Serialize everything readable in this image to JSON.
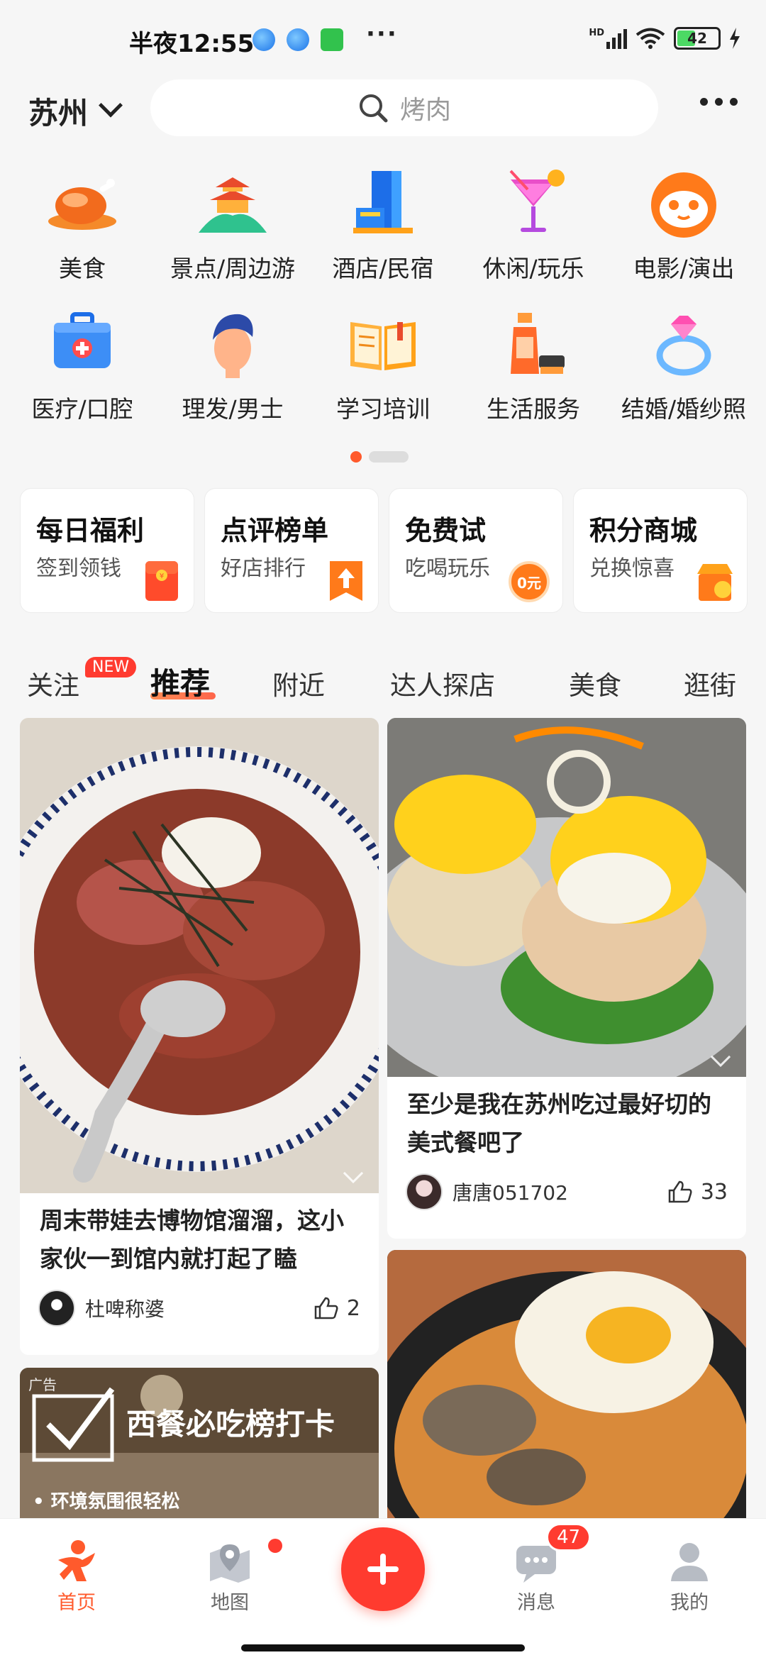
{
  "status_bar": {
    "time": "半夜12:55",
    "battery": "42",
    "network": "HD"
  },
  "header": {
    "city": "苏州",
    "search_placeholder": "烤肉"
  },
  "categories": [
    {
      "label": "美食",
      "icon": "roast-chicken-icon"
    },
    {
      "label": "景点/周边游",
      "icon": "pavilion-icon"
    },
    {
      "label": "酒店/民宿",
      "icon": "hotel-building-icon"
    },
    {
      "label": "休闲/玩乐",
      "icon": "cocktail-icon"
    },
    {
      "label": "电影/演出",
      "icon": "cat-face-icon"
    },
    {
      "label": "医疗/口腔",
      "icon": "medical-kit-icon"
    },
    {
      "label": "理发/男士",
      "icon": "haircut-head-icon"
    },
    {
      "label": "学习培训",
      "icon": "open-book-icon"
    },
    {
      "label": "生活服务",
      "icon": "cleaning-spray-icon"
    },
    {
      "label": "结婚/婚纱照",
      "icon": "diamond-ring-icon"
    }
  ],
  "promos": [
    {
      "title": "每日福利",
      "subtitle": "签到领钱"
    },
    {
      "title": "点评榜单",
      "subtitle": "好店排行"
    },
    {
      "title": "免费试",
      "subtitle": "吃喝玩乐",
      "badge": "0元"
    },
    {
      "title": "积分商城",
      "subtitle": "兑换惊喜"
    }
  ],
  "feed_tabs": {
    "follow": "关注",
    "follow_badge": "NEW",
    "recommend": "推荐",
    "nearby": "附近",
    "expert": "达人探店",
    "food": "美食",
    "shopping": "逛街"
  },
  "feed": {
    "left_card": {
      "title": "周末带娃去博物馆溜溜，这小家伙一到馆内就打起了瞌",
      "author": "杜啤称婆",
      "likes": "2"
    },
    "right_card": {
      "title": "至少是我在苏州吃过最好切的美式餐吧了",
      "author": "唐唐051702",
      "likes": "33"
    },
    "ad_card": {
      "tag": "广告",
      "headline": "西餐必吃榜打卡",
      "subtitle": "• 环境氛围很轻松"
    }
  },
  "bottom_nav": {
    "home": "首页",
    "map": "地图",
    "messages": "消息",
    "messages_badge": "47",
    "profile": "我的"
  },
  "colors": {
    "accent": "#ff5a2c",
    "badge": "#ff3b30"
  }
}
